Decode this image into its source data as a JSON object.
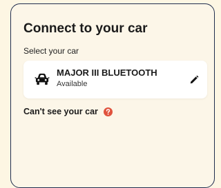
{
  "dialog": {
    "title": "Connect to your car",
    "subtitle": "Select your car"
  },
  "car": {
    "name": "MAJOR III BLUETOOTH",
    "status": "Available",
    "icon": "car-icon"
  },
  "help": {
    "label": "Can't see your car",
    "icon": "question-circle-icon",
    "icon_color": "#e0533d"
  },
  "colors": {
    "panel_border": "#1f2c4d",
    "background": "#fdf6e3"
  }
}
